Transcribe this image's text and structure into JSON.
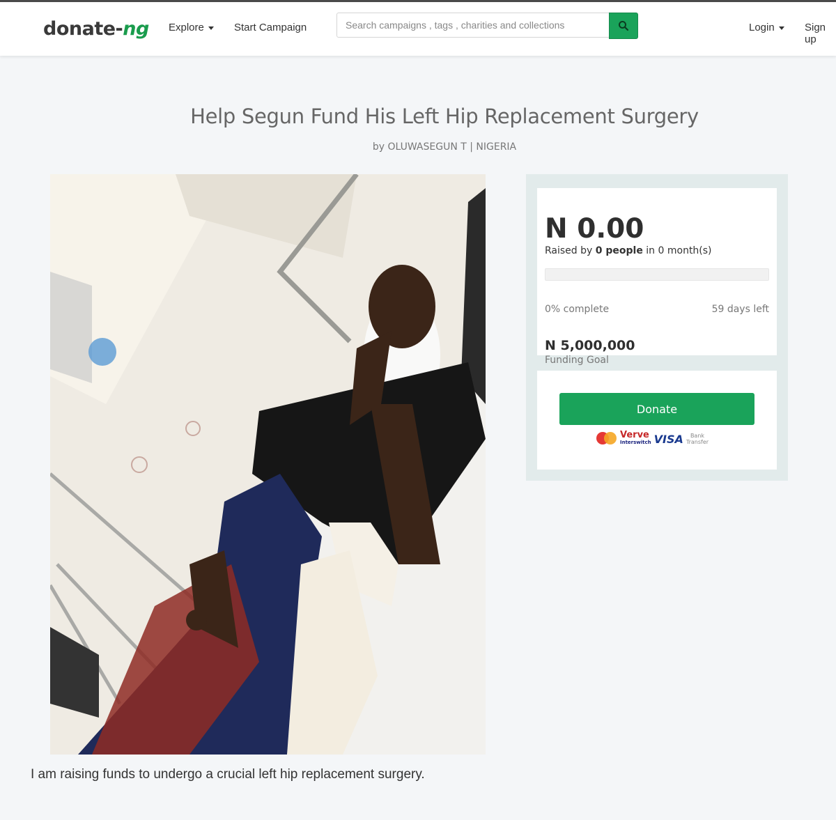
{
  "nav": {
    "logo_main": "donate-",
    "logo_accent": "ng",
    "explore": "Explore",
    "start_campaign": "Start Campaign",
    "search_placeholder": "Search campaigns , tags , charities and collections",
    "login": "Login",
    "signup": "Sign up"
  },
  "campaign": {
    "title": "Help Segun Fund His Left Hip Replacement Surgery",
    "byline": "by OLUWASEGUN T | NIGERIA",
    "description": "I am raising funds to undergo a crucial left hip replacement surgery."
  },
  "stats": {
    "amount_raised": "N 0.00",
    "raised_prefix": "Raised by ",
    "people": "0 people",
    "raised_suffix": " in 0 month(s)",
    "progress_fraction": 0,
    "percent_complete": "0% complete",
    "days_left": "59 days left",
    "goal": "N 5,000,000",
    "goal_label": "Funding Goal"
  },
  "donate": {
    "button": "Donate",
    "verve": "Verve",
    "interswitch": "Interswitch",
    "visa": "VISA",
    "bank_line1": "Bank",
    "bank_line2": "Transfer"
  },
  "colors": {
    "accent": "#1aa35a",
    "panel": "#e2ebeb"
  }
}
